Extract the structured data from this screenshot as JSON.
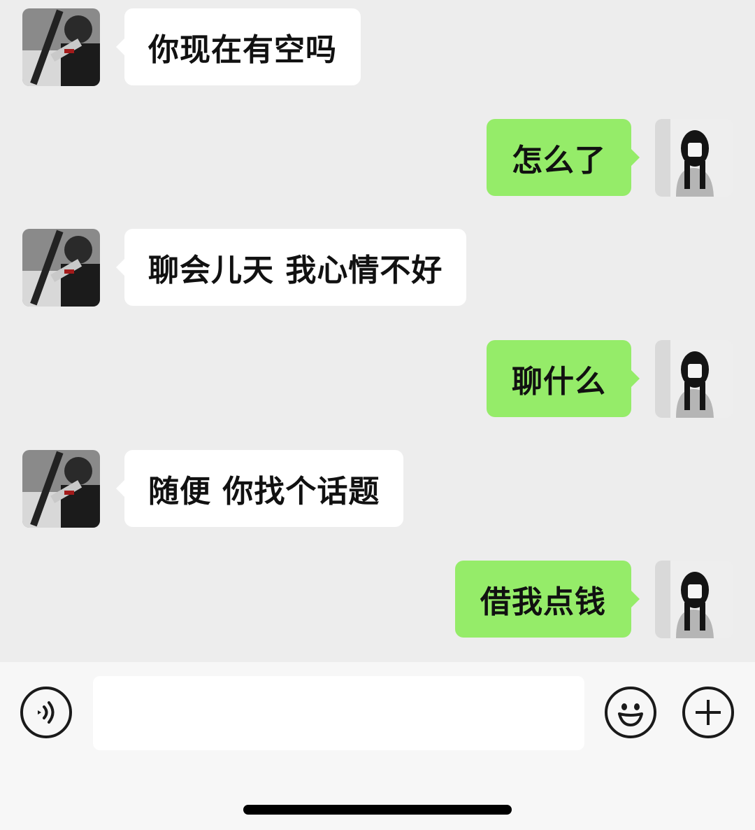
{
  "chat": {
    "contact_avatar_icon": "avatar-contact-icon",
    "self_avatar_icon": "avatar-self-icon",
    "messages": [
      {
        "from": "contact",
        "text": "你现在有空吗"
      },
      {
        "from": "self",
        "text": "怎么了"
      },
      {
        "from": "contact",
        "text": "聊会儿天 我心情不好"
      },
      {
        "from": "self",
        "text": "聊什么"
      },
      {
        "from": "contact",
        "text": "随便 你找个话题"
      },
      {
        "from": "self",
        "text": "借我点钱"
      }
    ]
  },
  "input_bar": {
    "voice_icon": "voice-icon",
    "input_value": "",
    "emoji_icon": "emoji-icon",
    "plus_icon": "plus-icon"
  },
  "colors": {
    "background": "#ededed",
    "incoming_bubble": "#ffffff",
    "outgoing_bubble": "#95ec69",
    "input_bar": "#f7f7f7"
  }
}
